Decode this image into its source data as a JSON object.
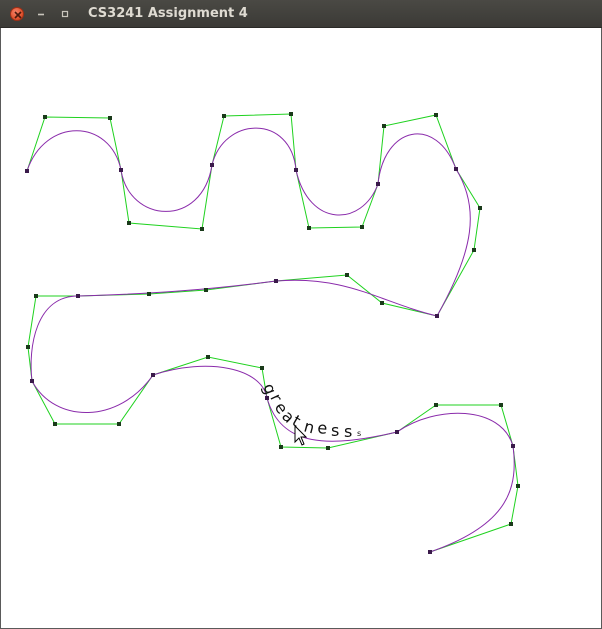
{
  "window": {
    "title": "CS3241 Assignment 4",
    "controls": [
      "close-icon",
      "minimize-icon",
      "maximize-icon"
    ]
  },
  "canvas": {
    "background": "#ffffff",
    "curve_color": "#8a2bab",
    "control_polygon_color": "#1fd21f",
    "control_point_color": "#1a1a1a",
    "text_color": "#111111",
    "handwritten_text": "greatness"
  }
}
